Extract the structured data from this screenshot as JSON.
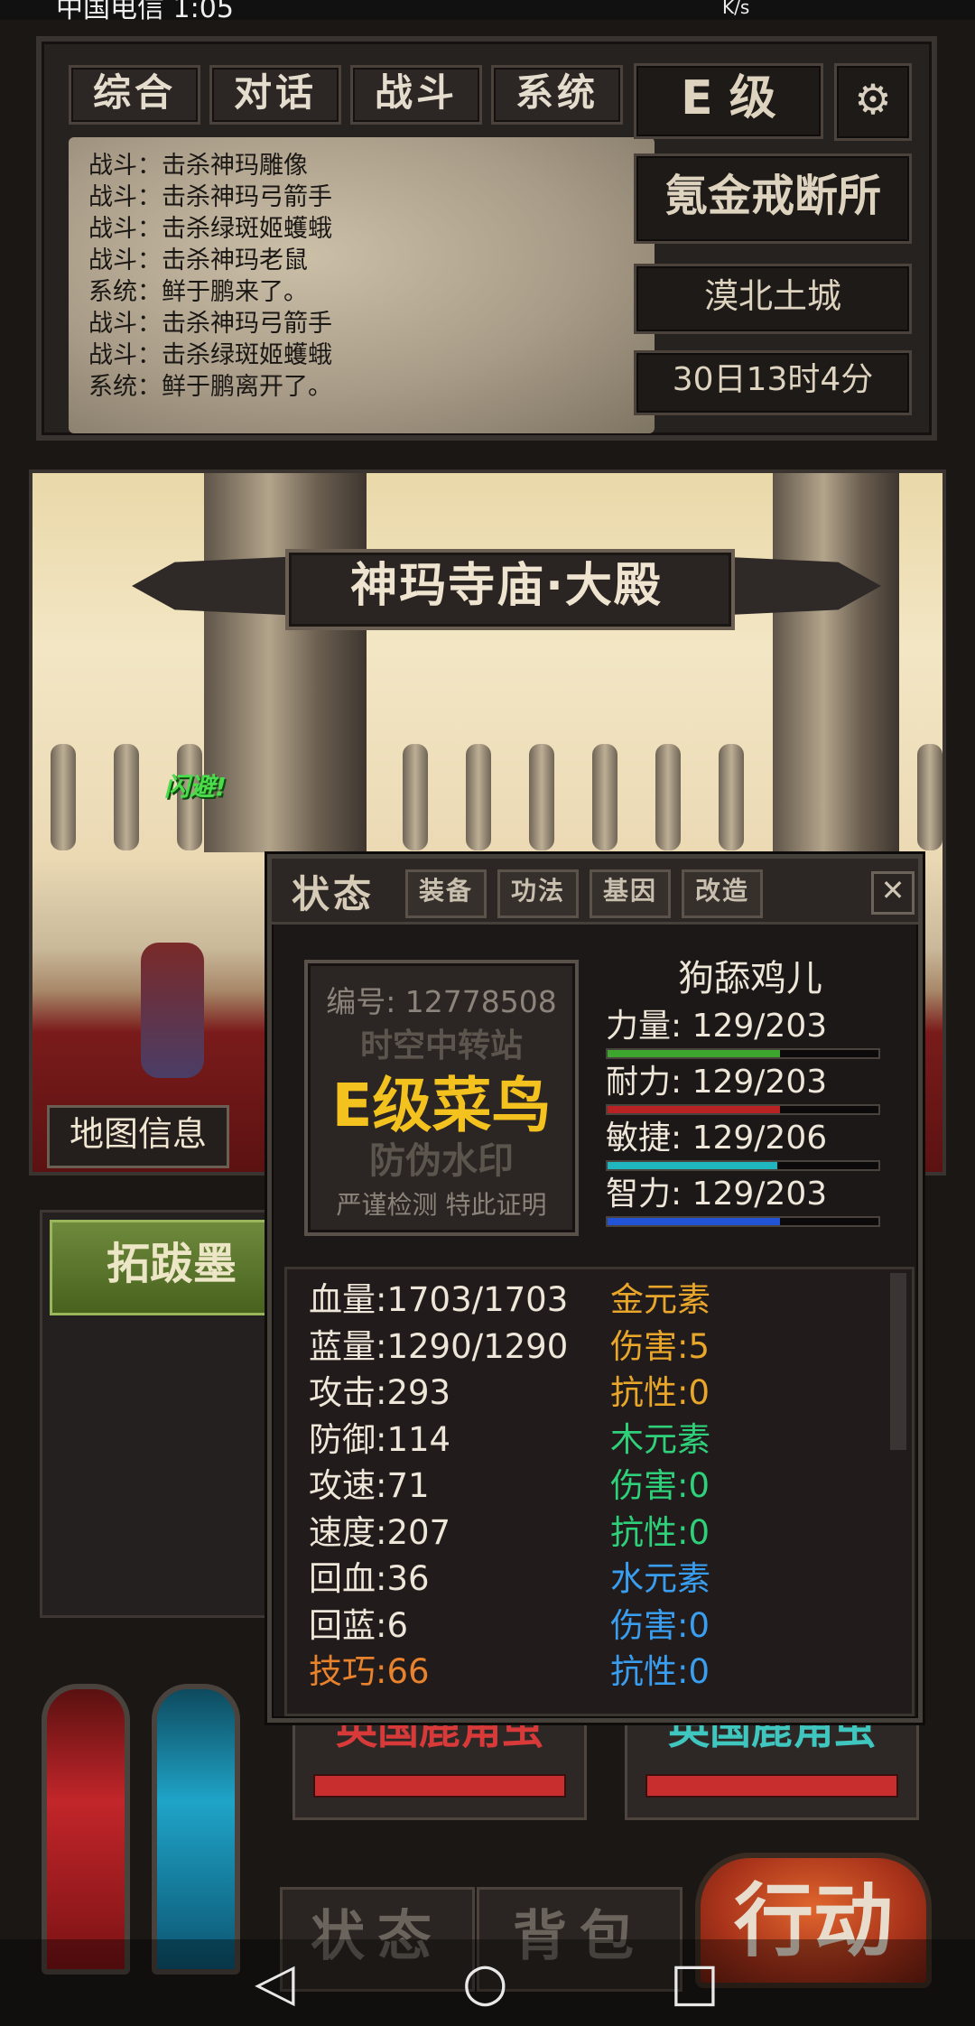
{
  "status_bar": {
    "carrier": "中国电信 1:05",
    "speed_unit": "K/s"
  },
  "top_tabs": [
    "综合",
    "对话",
    "战斗",
    "系统"
  ],
  "chat_log": [
    "战斗：击杀神玛雕像",
    "战斗：击杀神玛弓箭手",
    "战斗：击杀绿斑姬蠖蛾",
    "战斗：击杀神玛老鼠",
    "系统：鲜于鹏来了。",
    "战斗：击杀神玛弓箭手",
    "战斗：击杀绿斑姬蠖蛾",
    "系统：鲜于鹏离开了。"
  ],
  "rank": "E 级",
  "guild": "氪金戒断所",
  "city": "漠北土城",
  "game_time": "30日13时4分",
  "scene": {
    "location": "神玛寺庙·大殿",
    "dodge_text": "闪避!",
    "map_info_button": "地图信息"
  },
  "target_list": {
    "selected": "拓跋墨"
  },
  "monsters": [
    {
      "name": "英国鹿角虫",
      "color": "#d83a3a",
      "hp_fraction": 1.0
    },
    {
      "name": "英国鹿角虫",
      "color": "#3fc6bf",
      "hp_fraction": 1.0
    }
  ],
  "bottom_nav": {
    "status": "状态",
    "bag": "背包",
    "action": "行动"
  },
  "system_nav": {
    "back": "◁",
    "home": "○",
    "recent": "□"
  },
  "dialog": {
    "title": "状态",
    "tabs": [
      "装备",
      "功法",
      "基因",
      "改造"
    ],
    "close": "✕",
    "certificate": {
      "id": "编号: 12778508",
      "station": "时空中转站",
      "grade": "E级菜鸟",
      "watermark": "防伪水印",
      "note": "严谨检测 特此证明"
    },
    "character_name": "狗舔鸡儿",
    "attributes": [
      {
        "label": "力量: 129/203",
        "value": 129,
        "max": 203,
        "color": "#3ca62e"
      },
      {
        "label": "耐力: 129/203",
        "value": 129,
        "max": 203,
        "color": "#b82222"
      },
      {
        "label": "敏捷: 129/206",
        "value": 129,
        "max": 206,
        "color": "#1fb6c0"
      },
      {
        "label": "智力: 129/203",
        "value": 129,
        "max": 203,
        "color": "#2254d8"
      }
    ],
    "stats_left": [
      {
        "text": "血量:1703/1703",
        "color": "#eee6d8"
      },
      {
        "text": "蓝量:1290/1290",
        "color": "#eee6d8"
      },
      {
        "text": "攻击:293",
        "color": "#eee6d8"
      },
      {
        "text": "防御:114",
        "color": "#eee6d8"
      },
      {
        "text": "攻速:71",
        "color": "#eee6d8"
      },
      {
        "text": "速度:207",
        "color": "#eee6d8"
      },
      {
        "text": "回血:36",
        "color": "#eee6d8"
      },
      {
        "text": "回蓝:6",
        "color": "#eee6d8"
      },
      {
        "text": "技巧:66",
        "color": "#e9822c"
      }
    ],
    "stats_right": [
      {
        "text": "金元素",
        "color": "#e8a62a"
      },
      {
        "text": "伤害:5",
        "color": "#e8a62a"
      },
      {
        "text": "抗性:0",
        "color": "#e8a62a"
      },
      {
        "text": "木元素",
        "color": "#2fd07a"
      },
      {
        "text": "伤害:0",
        "color": "#2fd07a"
      },
      {
        "text": "抗性:0",
        "color": "#2fd07a"
      },
      {
        "text": "水元素",
        "color": "#3a9ef0"
      },
      {
        "text": "伤害:0",
        "color": "#3a9ef0"
      },
      {
        "text": "抗性:0",
        "color": "#3a9ef0"
      }
    ]
  }
}
